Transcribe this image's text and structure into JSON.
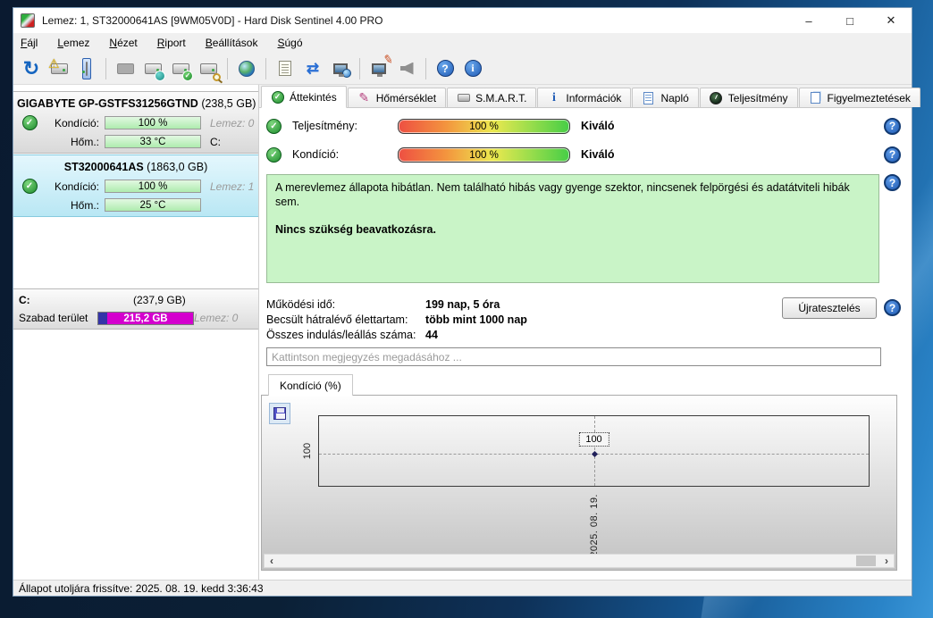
{
  "window": {
    "title": "Lemez: 1, ST32000641AS [9WM05V0D]  -  Hard Disk Sentinel 4.00 PRO",
    "controls": {
      "minimize": "–",
      "maximize": "□",
      "close": "✕"
    }
  },
  "menu": {
    "items": [
      {
        "label": "Fájl"
      },
      {
        "label": "Lemez"
      },
      {
        "label": "Nézet"
      },
      {
        "label": "Riport"
      },
      {
        "label": "Beállítások"
      },
      {
        "label": "Súgó"
      }
    ]
  },
  "toolbar": {
    "icons": [
      "refresh",
      "disk-warning",
      "disk-select",
      "disk-disabled",
      "disk-clock",
      "disk-check",
      "disk-search",
      "network-disk",
      "report",
      "mail-sync",
      "remote-computer",
      "display-settings",
      "sound",
      "help",
      "info"
    ]
  },
  "sidebar": {
    "disks": [
      {
        "name": "GIGABYTE GP-GSTFS31256GTND",
        "size": "(238,5 GB)",
        "condition_label": "Kondíció:",
        "condition_value": "100 %",
        "disk_label": "Lemez: 0",
        "temp_label": "Hőm.:",
        "temp_value": "33 °C",
        "drive_letters": "C:"
      },
      {
        "name": "ST32000641AS",
        "size": "(1863,0 GB)",
        "condition_label": "Kondíció:",
        "condition_value": "100 %",
        "disk_label": "Lemez: 1",
        "temp_label": "Hőm.:",
        "temp_value": "25 °C",
        "drive_letters": ""
      }
    ],
    "partition": {
      "letter": "C:",
      "size": "(237,9 GB)",
      "free_label": "Szabad terület",
      "free_value": "215,2 GB",
      "disk_label": "Lemez: 0"
    }
  },
  "tabs": [
    {
      "label": "Áttekintés",
      "active": true
    },
    {
      "label": "Hőmérséklet",
      "active": false
    },
    {
      "label": "S.M.A.R.T.",
      "active": false
    },
    {
      "label": "Információk",
      "active": false
    },
    {
      "label": "Napló",
      "active": false
    },
    {
      "label": "Teljesítmény",
      "active": false
    },
    {
      "label": "Figyelmeztetések",
      "active": false
    }
  ],
  "overview": {
    "performance_label": "Teljesítmény:",
    "performance_value": "100 %",
    "performance_rating": "Kiváló",
    "condition_label": "Kondíció:",
    "condition_value": "100 %",
    "condition_rating": "Kiváló",
    "status_text": "A merevlemez állapota hibátlan. Nem található hibás vagy gyenge szektor, nincsenek felpörgési és adatátviteli hibák sem.",
    "advice_text": "Nincs szükség beavatkozásra.",
    "stats": [
      {
        "label": "Működési idő:",
        "value": "199 nap, 5 óra"
      },
      {
        "label": "Becsült hátralévő élettartam:",
        "value": "több mint 1000 nap"
      },
      {
        "label": "Összes indulás/leállás száma:",
        "value": "44"
      }
    ],
    "retest_button": "Újratesztelés",
    "comment_placeholder": "Kattintson megjegyzés megadásához ...",
    "chart_tab": "Kondíció  (%)"
  },
  "chart": {
    "ytick": "100",
    "point_label": "100",
    "x_date": "2025. 08. 19.",
    "scroll_left": "‹",
    "scroll_right": "›"
  },
  "chart_data": {
    "type": "line",
    "title": "Kondíció (%)",
    "x": [
      "2025. 08. 19."
    ],
    "series": [
      {
        "name": "Kondíció (%)",
        "values": [
          100
        ]
      }
    ],
    "yticks": [
      100
    ],
    "point_labels": [
      "100"
    ],
    "grid": "dashed",
    "legend": "none"
  },
  "statusbar": {
    "text": "Állapot utoljára frissítve: 2025. 08. 19. kedd 3:36:43"
  }
}
